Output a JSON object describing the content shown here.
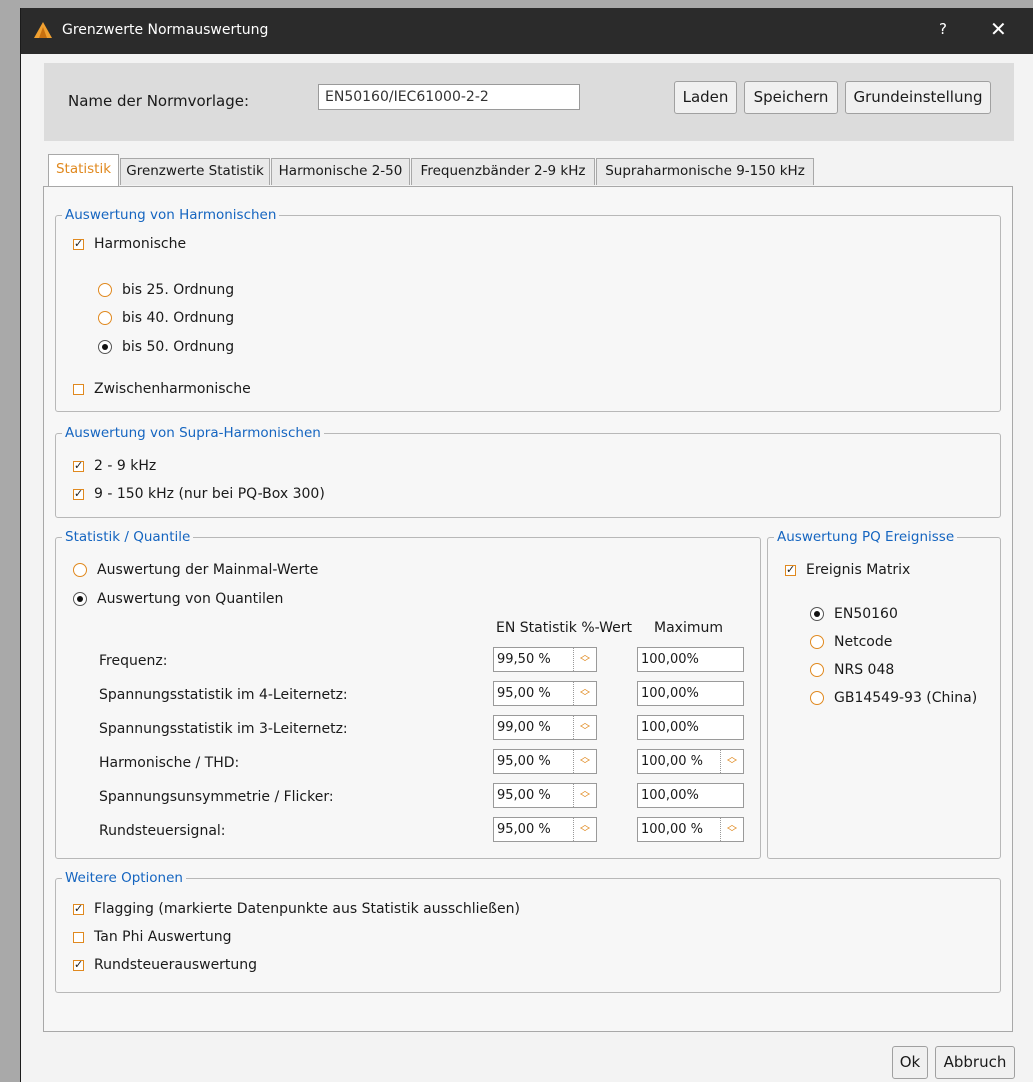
{
  "window": {
    "title": "Grenzwerte Normauswertung",
    "help": "?",
    "close": "✕"
  },
  "header": {
    "template_label": "Name der Normvorlage:",
    "template_value": "EN50160/IEC61000-2-2",
    "buttons": {
      "load": "Laden",
      "save": "Speichern",
      "default": "Grundeinstellung"
    }
  },
  "tabs": [
    "Statistik",
    "Grenzwerte Statistik",
    "Harmonische 2-50",
    "Frequenzbänder 2-9 kHz",
    "Supraharmonische 9-150 kHz"
  ],
  "harmonics": {
    "legend": "Auswertung von Harmonischen",
    "harmonics_label": "Harmonische",
    "harmonics_checked": true,
    "order_options": [
      "bis 25. Ordnung",
      "bis 40. Ordnung",
      "bis 50. Ordnung"
    ],
    "order_selected": "bis 50. Ordnung",
    "interharmonics_label": "Zwischenharmonische",
    "interharmonics_checked": false
  },
  "supra": {
    "legend": "Auswertung von Supra-Harmonischen",
    "options": [
      {
        "label": "2 - 9 kHz",
        "checked": true
      },
      {
        "label": "9 - 150 kHz (nur bei PQ-Box 300)",
        "checked": true
      }
    ]
  },
  "statistics": {
    "legend": "Statistik / Quantile",
    "mode_options": [
      "Auswertung der Mainmal-Werte",
      "Auswertung von Quantilen"
    ],
    "mode_selected": "Auswertung von Quantilen",
    "col_en": "EN Statistik %-Wert",
    "col_max": "Maximum",
    "rows": [
      {
        "label": "Frequenz:",
        "en": "99,50 %",
        "max": "100,00%"
      },
      {
        "label": "Spannungsstatistik im 4-Leiternetz:",
        "en": "95,00 %",
        "max": "100,00%"
      },
      {
        "label": "Spannungsstatistik im 3-Leiternetz:",
        "en": "99,00 %",
        "max": "100,00%"
      },
      {
        "label": "Harmonische / THD:",
        "en": "95,00 %",
        "max": "100,00 %"
      },
      {
        "label": "Spannungsunsymmetrie / Flicker:",
        "en": "95,00 %",
        "max": "100,00%"
      },
      {
        "label": "Rundsteuersignal:",
        "en": "95,00 %",
        "max": "100,00 %"
      }
    ]
  },
  "events": {
    "legend": "Auswertung PQ Ereignisse",
    "matrix_label": "Ereignis Matrix",
    "matrix_checked": true,
    "options": [
      "EN50160",
      "Netcode",
      "NRS 048",
      "GB14549-93 (China)"
    ],
    "selected": "EN50160"
  },
  "more": {
    "legend": "Weitere Optionen",
    "options": [
      {
        "label": "Flagging (markierte Datenpunkte aus Statistik ausschließen)",
        "checked": true
      },
      {
        "label": "Tan Phi Auswertung",
        "checked": false
      },
      {
        "label": "Rundsteuerauswertung",
        "checked": true
      }
    ]
  },
  "footer": {
    "ok": "Ok",
    "cancel": "Abbruch"
  },
  "colors": {
    "accent": "#e0891f",
    "legend": "#1565c0",
    "titlebar": "#2b2b2b"
  }
}
